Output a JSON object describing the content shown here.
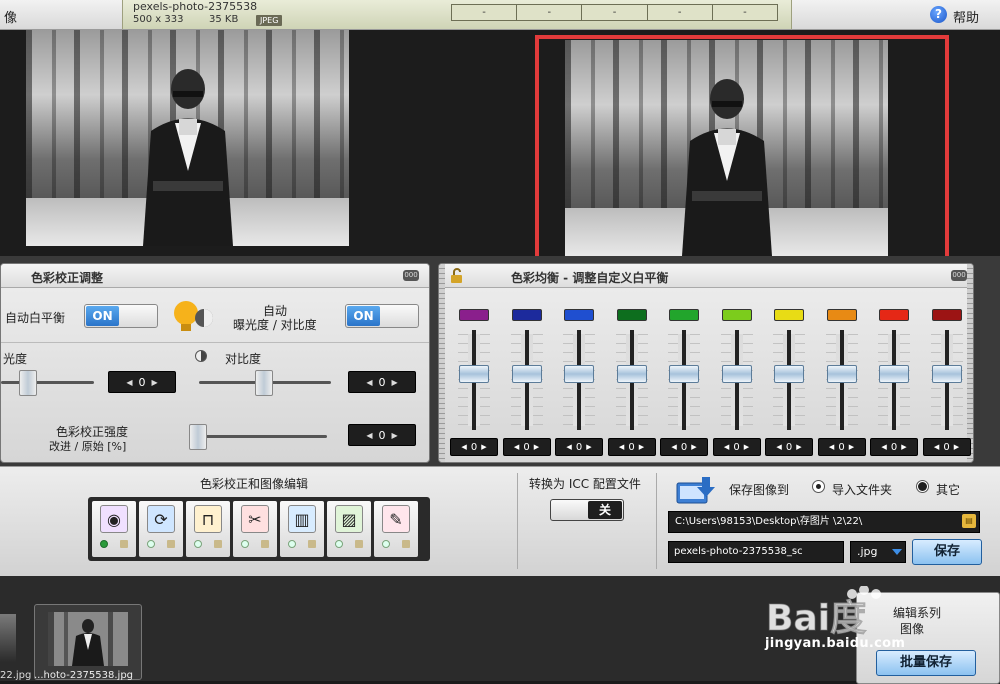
{
  "topbar": {
    "left_label": "像",
    "file": {
      "name": "pexels-photo-2375538",
      "dimensions": "500 x 333",
      "size": "35 KB",
      "format": "JPEG"
    },
    "dash_boxes": [
      "-",
      "-",
      "-",
      "-",
      "-"
    ],
    "help_label": "帮助"
  },
  "color_correction": {
    "title": "色彩校正调整",
    "auto_wb_label": "自动白平衡",
    "auto_wb_toggle": "ON",
    "auto_exposure_label_1": "自动",
    "auto_exposure_label_2": "曝光度 / 对比度",
    "auto_exposure_toggle": "ON",
    "brightness_label": "光度",
    "brightness_value": "0",
    "contrast_label": "对比度",
    "contrast_value": "0",
    "strength_label_1": "色彩校正强度",
    "strength_label_2": "改进 / 原始 [%]",
    "strength_value": "0",
    "panel_button": "000"
  },
  "custom_wb": {
    "title": "色彩均衡 - 调整自定义白平衡",
    "panel_button": "000",
    "channels": [
      {
        "color": "#8a1f8c",
        "value": "0"
      },
      {
        "color": "#1c2a9c",
        "value": "0"
      },
      {
        "color": "#1f4fd0",
        "value": "0"
      },
      {
        "color": "#0d6e1e",
        "value": "0"
      },
      {
        "color": "#22a52c",
        "value": "0"
      },
      {
        "color": "#7ccc1c",
        "value": "0"
      },
      {
        "color": "#e8dc15",
        "value": "0"
      },
      {
        "color": "#e88a14",
        "value": "0"
      },
      {
        "color": "#e52816",
        "value": "0"
      },
      {
        "color": "#9c1414",
        "value": "0"
      }
    ]
  },
  "toolbar": {
    "tools_title": "色彩校正和图像编辑",
    "tools": [
      {
        "icon": "color-wheel-icon",
        "glyph": "◉",
        "active": true
      },
      {
        "icon": "rotate-icon",
        "glyph": "⟳",
        "active": false
      },
      {
        "icon": "crop-icon",
        "glyph": "⊓",
        "active": false
      },
      {
        "icon": "cut-icon",
        "glyph": "✂",
        "active": false
      },
      {
        "icon": "straighten-icon",
        "glyph": "▥",
        "active": false
      },
      {
        "icon": "picture-effect-icon",
        "glyph": "▨",
        "active": false
      },
      {
        "icon": "eraser-icon",
        "glyph": "✎",
        "active": false
      }
    ],
    "icc_label": "转换为 ICC 配置文件",
    "icc_toggle": "关",
    "save_to_label": "保存图像到",
    "radio_import_label": "导入文件夹",
    "radio_other_label": "其它",
    "path_value": "C:\\Users\\98153\\Desktop\\存图片 \\2\\22\\",
    "filename_value": "pexels-photo-2375538_sc",
    "ext_value": ".jpg",
    "save_label": "保存"
  },
  "strip": {
    "thumb_1_label": "22.jpg",
    "thumb_2_label": "...hoto-2375538.jpg",
    "batch_line1": "编辑系列",
    "batch_line2": "图像",
    "batch_save_label": "批量保存"
  },
  "watermark": {
    "brand": "Bai度",
    "url": "jingyan.baidu.com"
  }
}
